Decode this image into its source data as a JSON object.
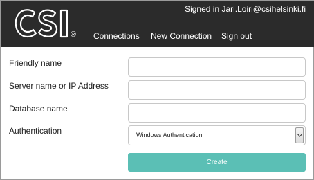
{
  "header": {
    "logo_text": "CSI",
    "registered_mark": "®",
    "signed_in_text": "Signed in Jari.Loiri@csihelsinki.fi",
    "nav": {
      "connections": "Connections",
      "new_connection": "New Connection",
      "sign_out": "Sign out"
    }
  },
  "form": {
    "friendly_name": {
      "label": "Friendly name",
      "value": ""
    },
    "server_name": {
      "label": "Server name or IP Address",
      "value": ""
    },
    "database_name": {
      "label": "Database name",
      "value": ""
    },
    "authentication": {
      "label": "Authentication",
      "selected": "Windows Authentication"
    },
    "create_label": "Create"
  },
  "colors": {
    "header_bg": "#2b2b2b",
    "button_bg": "#5bbfb5"
  }
}
